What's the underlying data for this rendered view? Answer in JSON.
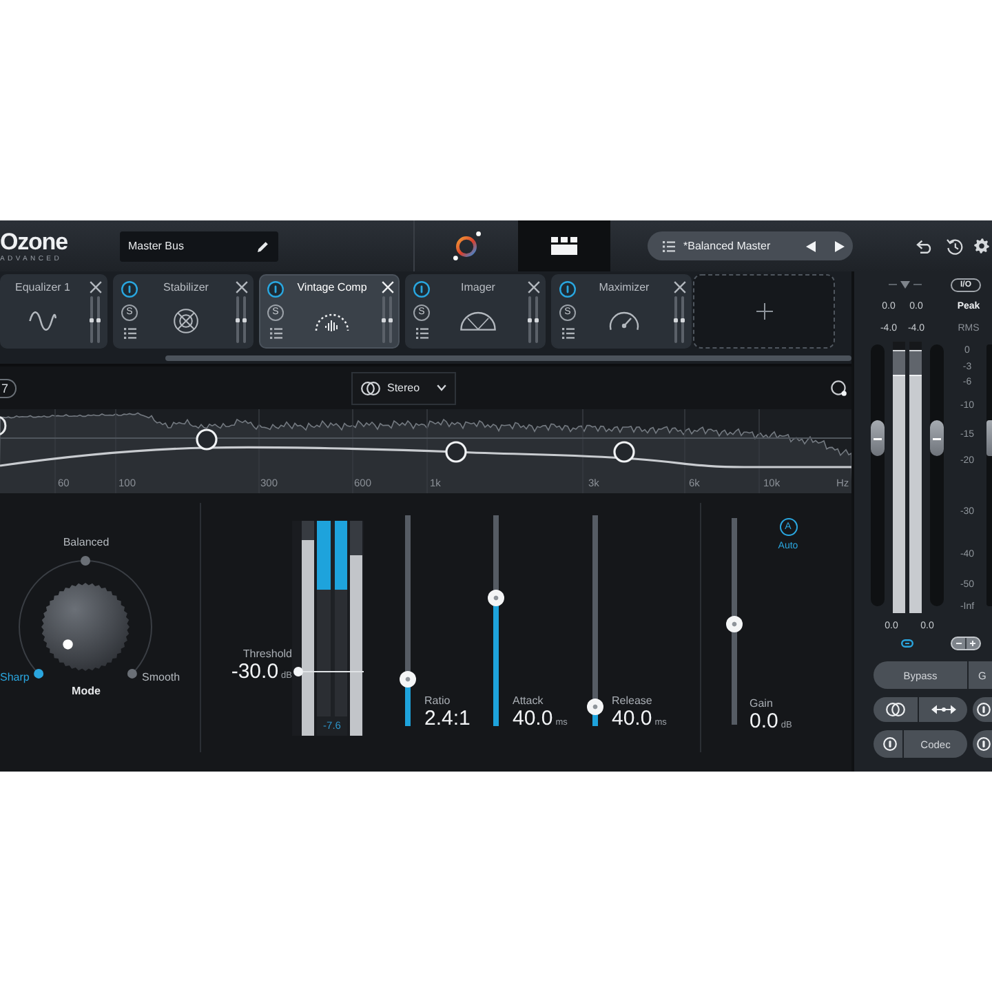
{
  "header": {
    "product": "Ozone",
    "edition": "ADVANCED",
    "chain_name": "Master Bus",
    "views": [
      {
        "kind": "assistant",
        "selected": false
      },
      {
        "kind": "modules",
        "selected": true
      }
    ],
    "preset": "*Balanced Master"
  },
  "modules": [
    {
      "kind": "equalizer",
      "name": "Equalizer 1",
      "selected": false
    },
    {
      "kind": "stabilizer",
      "name": "Stabilizer",
      "selected": false,
      "power": true,
      "solo_label": "S"
    },
    {
      "kind": "vintage-comp",
      "name": "Vintage Comp",
      "selected": true,
      "power": true,
      "solo_label": "S"
    },
    {
      "kind": "imager",
      "name": "Imager",
      "selected": false,
      "power": true,
      "solo_label": "S"
    },
    {
      "kind": "maximizer",
      "name": "Maximizer",
      "selected": false,
      "power": true,
      "solo_label": "S"
    }
  ],
  "eq": {
    "cut_button_label": "7",
    "channel_mode": "Stereo",
    "frequency_labels": [
      "60",
      "100",
      "300",
      "600",
      "1k",
      "3k",
      "6k",
      "10k",
      "Hz"
    ]
  },
  "mode_dial": {
    "label": "Mode",
    "options": [
      {
        "label": "Balanced",
        "selected": false
      },
      {
        "label": "Sharp",
        "selected": true
      },
      {
        "label": "Smooth",
        "selected": false
      }
    ]
  },
  "threshold": {
    "label": "Threshold",
    "value": "-30.0",
    "unit": "dB",
    "level": 0.3,
    "input_meters": [
      {
        "level": 0.91
      },
      {
        "level": 0.84
      }
    ],
    "reduction_meters": [
      {
        "level": 0.35
      },
      {
        "level": 0.35
      }
    ],
    "reduction_reading": "-7.6"
  },
  "sliders": [
    {
      "label": "Ratio",
      "value": "2.4:1",
      "level": 0.22
    },
    {
      "label": "Attack",
      "value": "40.0",
      "unit": "ms",
      "level": 0.61
    },
    {
      "label": "Release",
      "value": "40.0",
      "unit": "ms",
      "level": 0.09
    }
  ],
  "gain": {
    "label": "Gain",
    "value": "0.0",
    "unit": "dB",
    "level": 0.49,
    "auto": {
      "letter": "A",
      "label": "Auto",
      "on": true
    }
  },
  "output": {
    "io_label": "I/O",
    "peak_label": "Peak",
    "rms_label": "RMS",
    "peak_values": [
      "0.0",
      "0.0"
    ],
    "rms_values": [
      "-4.0",
      "-4.0"
    ],
    "channels": [
      {
        "peak": {
          "level": 0.97
        },
        "rms": {
          "level": 0.88
        }
      },
      {
        "peak": {
          "level": 0.97
        },
        "rms": {
          "level": 0.88
        }
      }
    ],
    "faders": [
      {
        "level": 0.64
      },
      {
        "level": 0.64
      },
      {
        "level": 0.64
      }
    ],
    "scale": [
      "0",
      "-3",
      "-6",
      "-10",
      "-15",
      "-20",
      "-30",
      "-40",
      "-50",
      "-Inf"
    ],
    "bottom_values": [
      "0.0",
      "0.0"
    ],
    "linked": true,
    "bypass_label": "Bypass",
    "cut_button_label": "G",
    "codec_label": "Codec"
  }
}
